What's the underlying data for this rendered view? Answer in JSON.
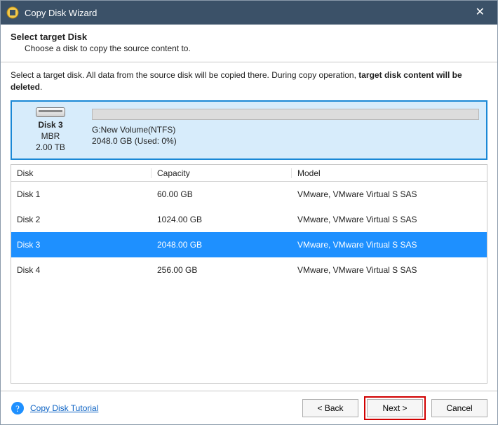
{
  "titlebar": {
    "title": "Copy Disk Wizard"
  },
  "header": {
    "title": "Select target Disk",
    "subtitle": "Choose a disk to copy the source content to."
  },
  "instruction": {
    "pre": "Select a target disk. All data from the source disk will be copied there. During copy operation, ",
    "emph": "target disk content will be deleted",
    "post": "."
  },
  "selected_disk": {
    "name": "Disk 3",
    "scheme": "MBR",
    "size": "2.00 TB",
    "volume_label": "G:New Volume(NTFS)",
    "volume_usage": "2048.0 GB (Used: 0%)"
  },
  "table": {
    "headers": {
      "disk": "Disk",
      "capacity": "Capacity",
      "model": "Model"
    },
    "rows": [
      {
        "disk": "Disk 1",
        "capacity": "60.00 GB",
        "model": "VMware, VMware Virtual S SAS",
        "selected": false
      },
      {
        "disk": "Disk 2",
        "capacity": "1024.00 GB",
        "model": "VMware, VMware Virtual S SAS",
        "selected": false
      },
      {
        "disk": "Disk 3",
        "capacity": "2048.00 GB",
        "model": "VMware, VMware Virtual S SAS",
        "selected": true
      },
      {
        "disk": "Disk 4",
        "capacity": "256.00 GB",
        "model": "VMware, VMware Virtual S SAS",
        "selected": false
      }
    ]
  },
  "footer": {
    "help_link": "Copy Disk Tutorial",
    "back": "< Back",
    "next": "Next >",
    "cancel": "Cancel"
  }
}
